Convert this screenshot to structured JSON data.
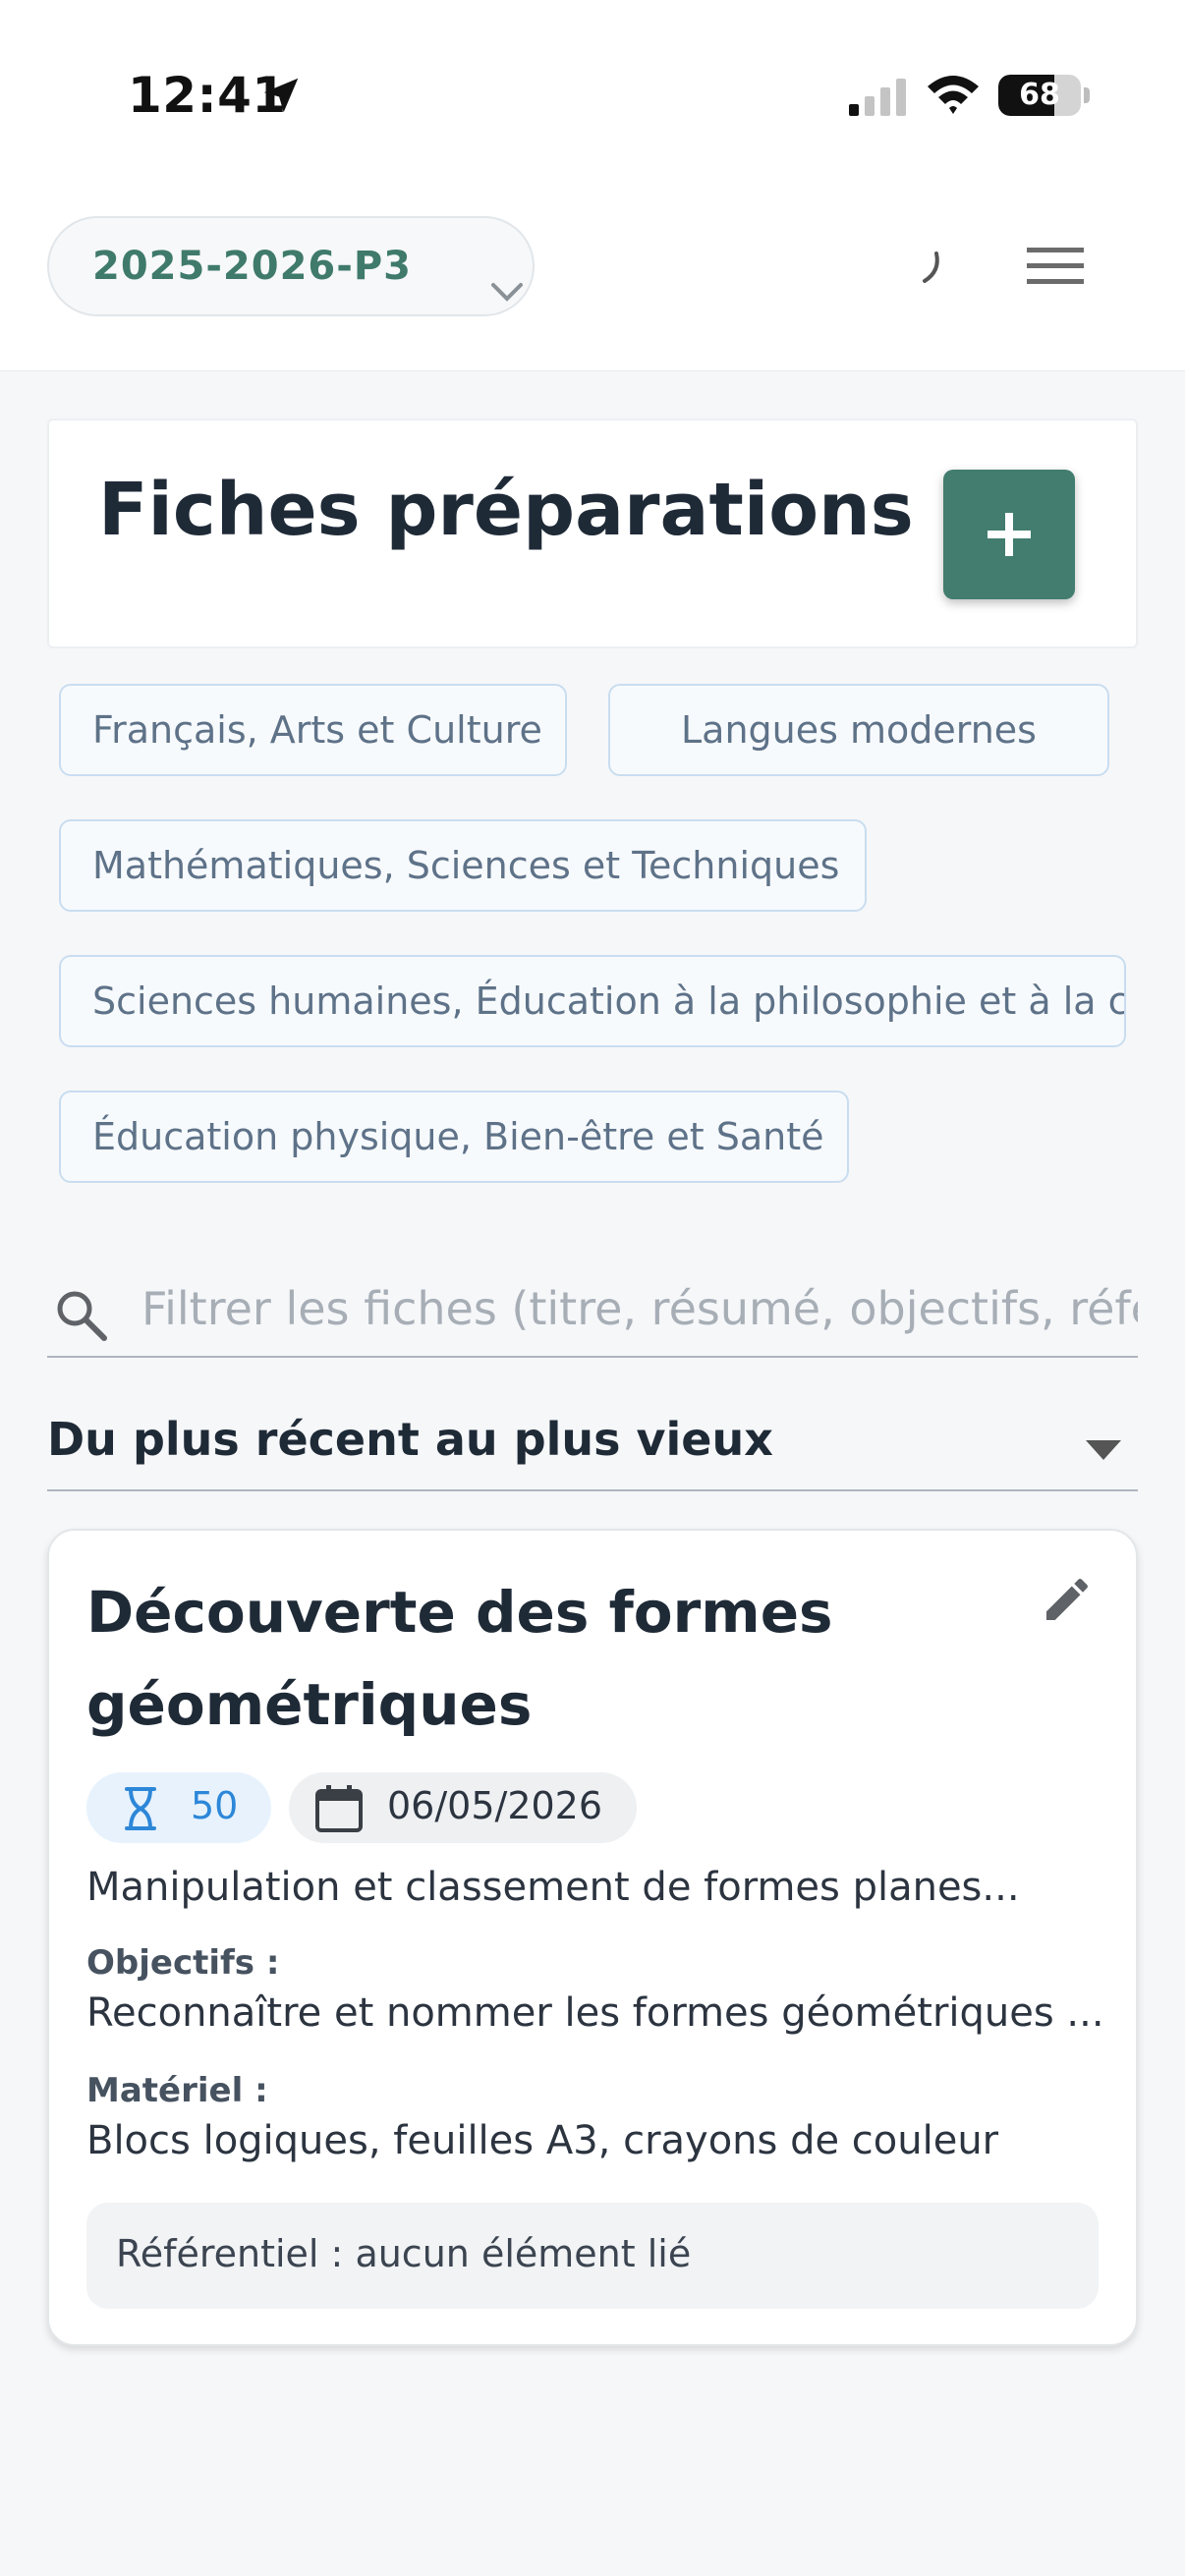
{
  "status_bar": {
    "time": "12:41",
    "battery": "68",
    "battery_level_percent": 68
  },
  "header": {
    "year_select": "2025-2026-P3"
  },
  "page": {
    "title": "Fiches préparations"
  },
  "subjects": [
    {
      "label": "Français, Arts et Culture"
    },
    {
      "label": "Langues modernes"
    },
    {
      "label": "Mathématiques, Sciences et Techniques"
    },
    {
      "label": "Sciences humaines, Éducation à la philosophie et à la citoyenneté"
    },
    {
      "label": "Éducation physique, Bien-être et Santé"
    }
  ],
  "search": {
    "placeholder": "Filtrer les fiches (titre, résumé, objectifs, référentiel...)"
  },
  "sort": {
    "selected": "Du plus récent au plus vieux"
  },
  "fiche": {
    "title": "Découverte des formes géométriques",
    "duration": "50",
    "date": "06/05/2026",
    "summary": "Manipulation et classement de formes planes...",
    "objectives_label": "Objectifs :",
    "objectives": "Reconnaître et nommer les formes géométriques ...",
    "material_label": "Matériel :",
    "material": "Blocs logiques, feuilles A3, crayons de couleur",
    "referentiel": "Référentiel : aucun élément lié"
  },
  "colors": {
    "accent": "#427d6f",
    "chip_border": "#c9ddf0",
    "duration_blue": "#2d87d8"
  },
  "icons": [
    "location-arrow-icon",
    "cell-signal-icon",
    "wifi-icon",
    "chevron-down-icon",
    "spinner-icon",
    "hamburger-menu-icon",
    "plus-icon",
    "search-icon",
    "caret-down-icon",
    "pencil-icon",
    "hourglass-icon",
    "calendar-icon"
  ]
}
